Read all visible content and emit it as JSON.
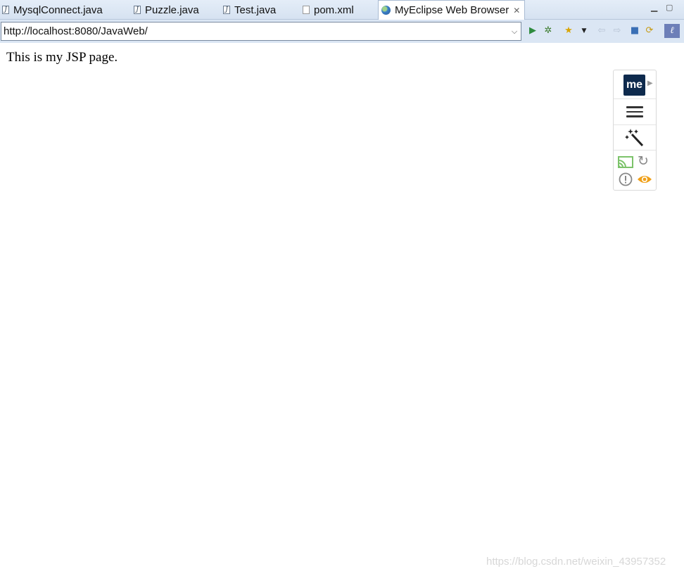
{
  "tabs": [
    {
      "label": "MysqlConnect.java",
      "icon": "java-file-icon"
    },
    {
      "label": "Puzzle.java",
      "icon": "java-file-icon"
    },
    {
      "label": "Test.java",
      "icon": "java-file-icon"
    },
    {
      "label": "pom.xml",
      "icon": "xml-file-icon"
    },
    {
      "label": "MyEclipse Web Browser",
      "icon": "globe-icon",
      "active": true
    }
  ],
  "address": {
    "url": "http://localhost:8080/JavaWeb/"
  },
  "page": {
    "text": "This is my JSP page."
  },
  "extension": {
    "logo_text": "me"
  },
  "watermark": "https://blog.csdn.net/weixin_43957352",
  "colors": {
    "accent": "#2e8b3e",
    "logo_bg": "#0e2a4d",
    "eye": "#f0a019"
  }
}
